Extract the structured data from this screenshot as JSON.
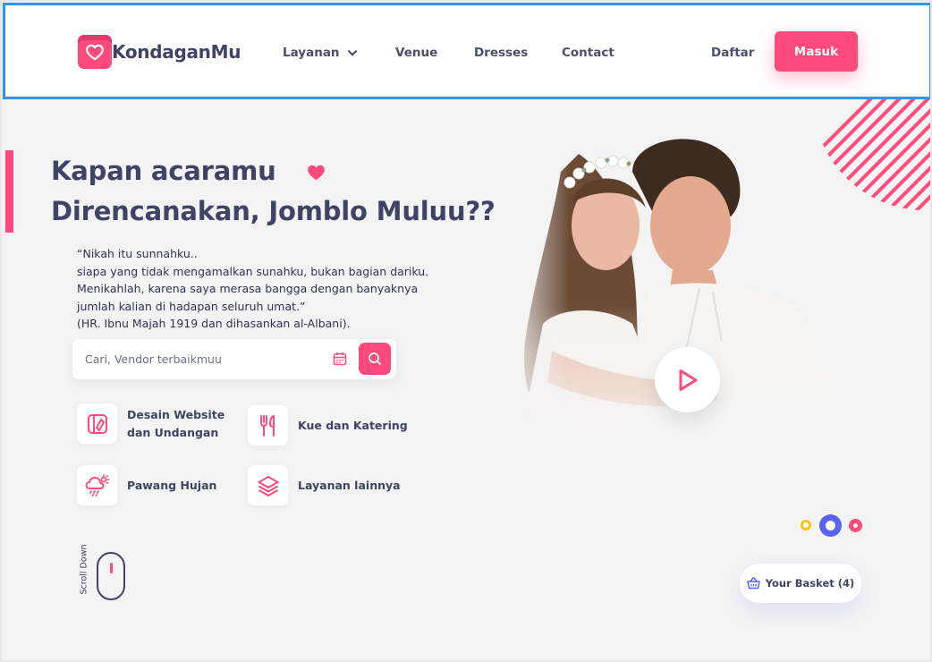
{
  "brand": {
    "name": "KondaganMu",
    "accent": "#ff4a7d",
    "dark": "#3f4465"
  },
  "nav": {
    "layanan": "Layanan",
    "venue": "Venue",
    "dresses": "Dresses",
    "contact": "Contact",
    "daftar": "Daftar",
    "masuk": "Masuk"
  },
  "hero": {
    "title_line1": "Kapan acaramu",
    "title_line2": "Direncanakan, Jomblo Muluu??",
    "quote": [
      "“Nikah itu sunnahku..",
      "siapa yang tidak mengamalkan sunahku, bukan bagian dariku.",
      "Menikahlah, karena saya merasa bangga dengan banyaknya",
      "jumlah kalian di hadapan seluruh umat.”",
      "(HR. Ibnu Majah 1919 dan dihasankan al-Albani)."
    ]
  },
  "search": {
    "placeholder": "Cari, Vendor terbaikmuu",
    "value": ""
  },
  "services": [
    {
      "line1": "Desain Website",
      "line2": "dan Undangan",
      "icon": "design-icon"
    },
    {
      "line1": "Kue dan Katering",
      "line2": "",
      "icon": "fork-icon"
    },
    {
      "line1": "Pawang Hujan",
      "line2": "",
      "icon": "weather-icon"
    },
    {
      "line1": "Layanan lainnya",
      "line2": "",
      "icon": "layers-icon"
    }
  ],
  "scroll": {
    "label": "Scroll Down"
  },
  "basket": {
    "label": "Your Basket (4)"
  }
}
